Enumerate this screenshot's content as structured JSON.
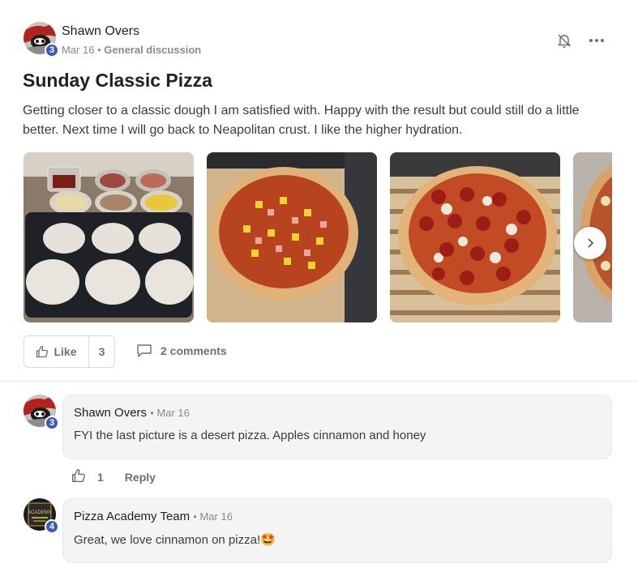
{
  "post": {
    "author": {
      "name": "Shawn Overs",
      "level": "3"
    },
    "date": "Mar 16",
    "separator": "•",
    "category": "General discussion",
    "title": "Sunday Classic Pizza",
    "body": "Getting closer to a classic dough I am satisfied with. Happy with the result but could still do a little better. Next time I will go back to Neapolitan crust. I like the higher hydration.",
    "images": [
      "dough-prep-photo",
      "hawaiian-pizza-photo",
      "pepperoni-pizza-photo",
      "dessert-pizza-photo"
    ],
    "actions": {
      "like_label": "Like",
      "like_count": "3",
      "comments_label": "2 comments"
    }
  },
  "comments": [
    {
      "author": "Shawn Overs",
      "level": "3",
      "date": "• Mar 16",
      "text": "FYI the last picture is a desert pizza. Apples cinnamon and honey",
      "like_count": "1",
      "reply_label": "Reply"
    },
    {
      "author": "Pizza Academy Team",
      "level": "4",
      "avatar_text": "ACADEMY",
      "date": "• Mar 16",
      "text": "Great, we love cinnamon on pizza!",
      "emoji": "🤩"
    }
  ],
  "colors": {
    "level_badge": "#3b5bb5",
    "bubble_bg": "#f4f4f4",
    "muted": "#8a8a8a"
  }
}
